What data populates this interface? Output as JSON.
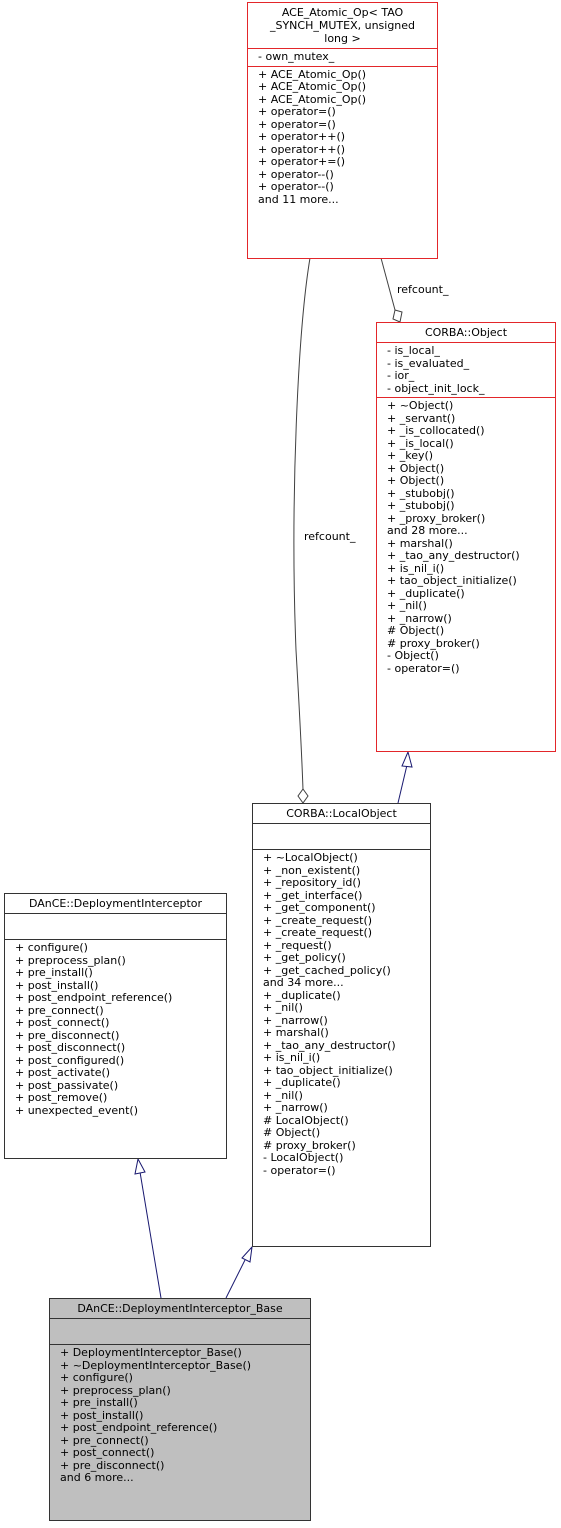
{
  "nodes": {
    "atomic_op": {
      "title": [
        "ACE_Atomic_Op< TAO",
        "_SYNCH_MUTEX, unsigned",
        "long >"
      ],
      "attributes": [
        "- own_mutex_"
      ],
      "methods": [
        "+ ACE_Atomic_Op()",
        "+ ACE_Atomic_Op()",
        "+ ACE_Atomic_Op()",
        "+ operator=()",
        "+ operator=()",
        "+ operator++()",
        "+ operator++()",
        "+ operator+=()",
        "+ operator--()",
        "+ operator--()",
        "and 11 more..."
      ]
    },
    "corba_object": {
      "title": [
        "CORBA::Object"
      ],
      "attributes": [
        "- is_local_",
        "- is_evaluated_",
        "- ior_",
        "- object_init_lock_"
      ],
      "methods": [
        "+ ~Object()",
        "+ _servant()",
        "+ _is_collocated()",
        "+ _is_local()",
        "+ _key()",
        "+ Object()",
        "+ Object()",
        "+ _stubobj()",
        "+ _stubobj()",
        "+ _proxy_broker()",
        "and 28 more...",
        "+ marshal()",
        "+ _tao_any_destructor()",
        "+ is_nil_i()",
        "+ tao_object_initialize()",
        "+ _duplicate()",
        "+ _nil()",
        "+ _narrow()",
        "# Object()",
        "# proxy_broker()",
        "- Object()",
        "- operator=()"
      ]
    },
    "local_object": {
      "title": [
        "CORBA::LocalObject"
      ],
      "attributes": [],
      "methods": [
        "+ ~LocalObject()",
        "+ _non_existent()",
        "+ _repository_id()",
        "+ _get_interface()",
        "+ _get_component()",
        "+ _create_request()",
        "+ _create_request()",
        "+ _request()",
        "+ _get_policy()",
        "+ _get_cached_policy()",
        "and 34 more...",
        "+ _duplicate()",
        "+ _nil()",
        "+ _narrow()",
        "+ marshal()",
        "+ _tao_any_destructor()",
        "+ is_nil_i()",
        "+ tao_object_initialize()",
        "+ _duplicate()",
        "+ _nil()",
        "+ _narrow()",
        "# LocalObject()",
        "# Object()",
        "# proxy_broker()",
        "- LocalObject()",
        "- operator=()"
      ]
    },
    "deployment_interceptor": {
      "title": [
        "DAnCE::DeploymentInterceptor"
      ],
      "attributes": [],
      "methods": [
        "+ configure()",
        "+ preprocess_plan()",
        "+ pre_install()",
        "+ post_install()",
        "+ post_endpoint_reference()",
        "+ pre_connect()",
        "+ post_connect()",
        "+ pre_disconnect()",
        "+ post_disconnect()",
        "+ post_configured()",
        "+ post_activate()",
        "+ post_passivate()",
        "+ post_remove()",
        "+ unexpected_event()"
      ]
    },
    "deployment_interceptor_base": {
      "title": [
        "DAnCE::DeploymentInterceptor_Base"
      ],
      "attributes": [],
      "methods": [
        "+ DeploymentInterceptor_Base()",
        "+ ~DeploymentInterceptor_Base()",
        "+ configure()",
        "+ preprocess_plan()",
        "+ pre_install()",
        "+ post_install()",
        "+ post_endpoint_reference()",
        "+ pre_connect()",
        "+ post_connect()",
        "+ pre_disconnect()",
        "and 6 more..."
      ]
    }
  },
  "edges": {
    "refcount_object_label": "refcount_",
    "refcount_local_label": "refcount_"
  },
  "colors": {
    "highlight_border": "#e3262a",
    "normal_border": "#333333",
    "focus_fill": "#bfbfbf",
    "inheritance_edge": "#191970",
    "composition_edge": "#404040"
  }
}
